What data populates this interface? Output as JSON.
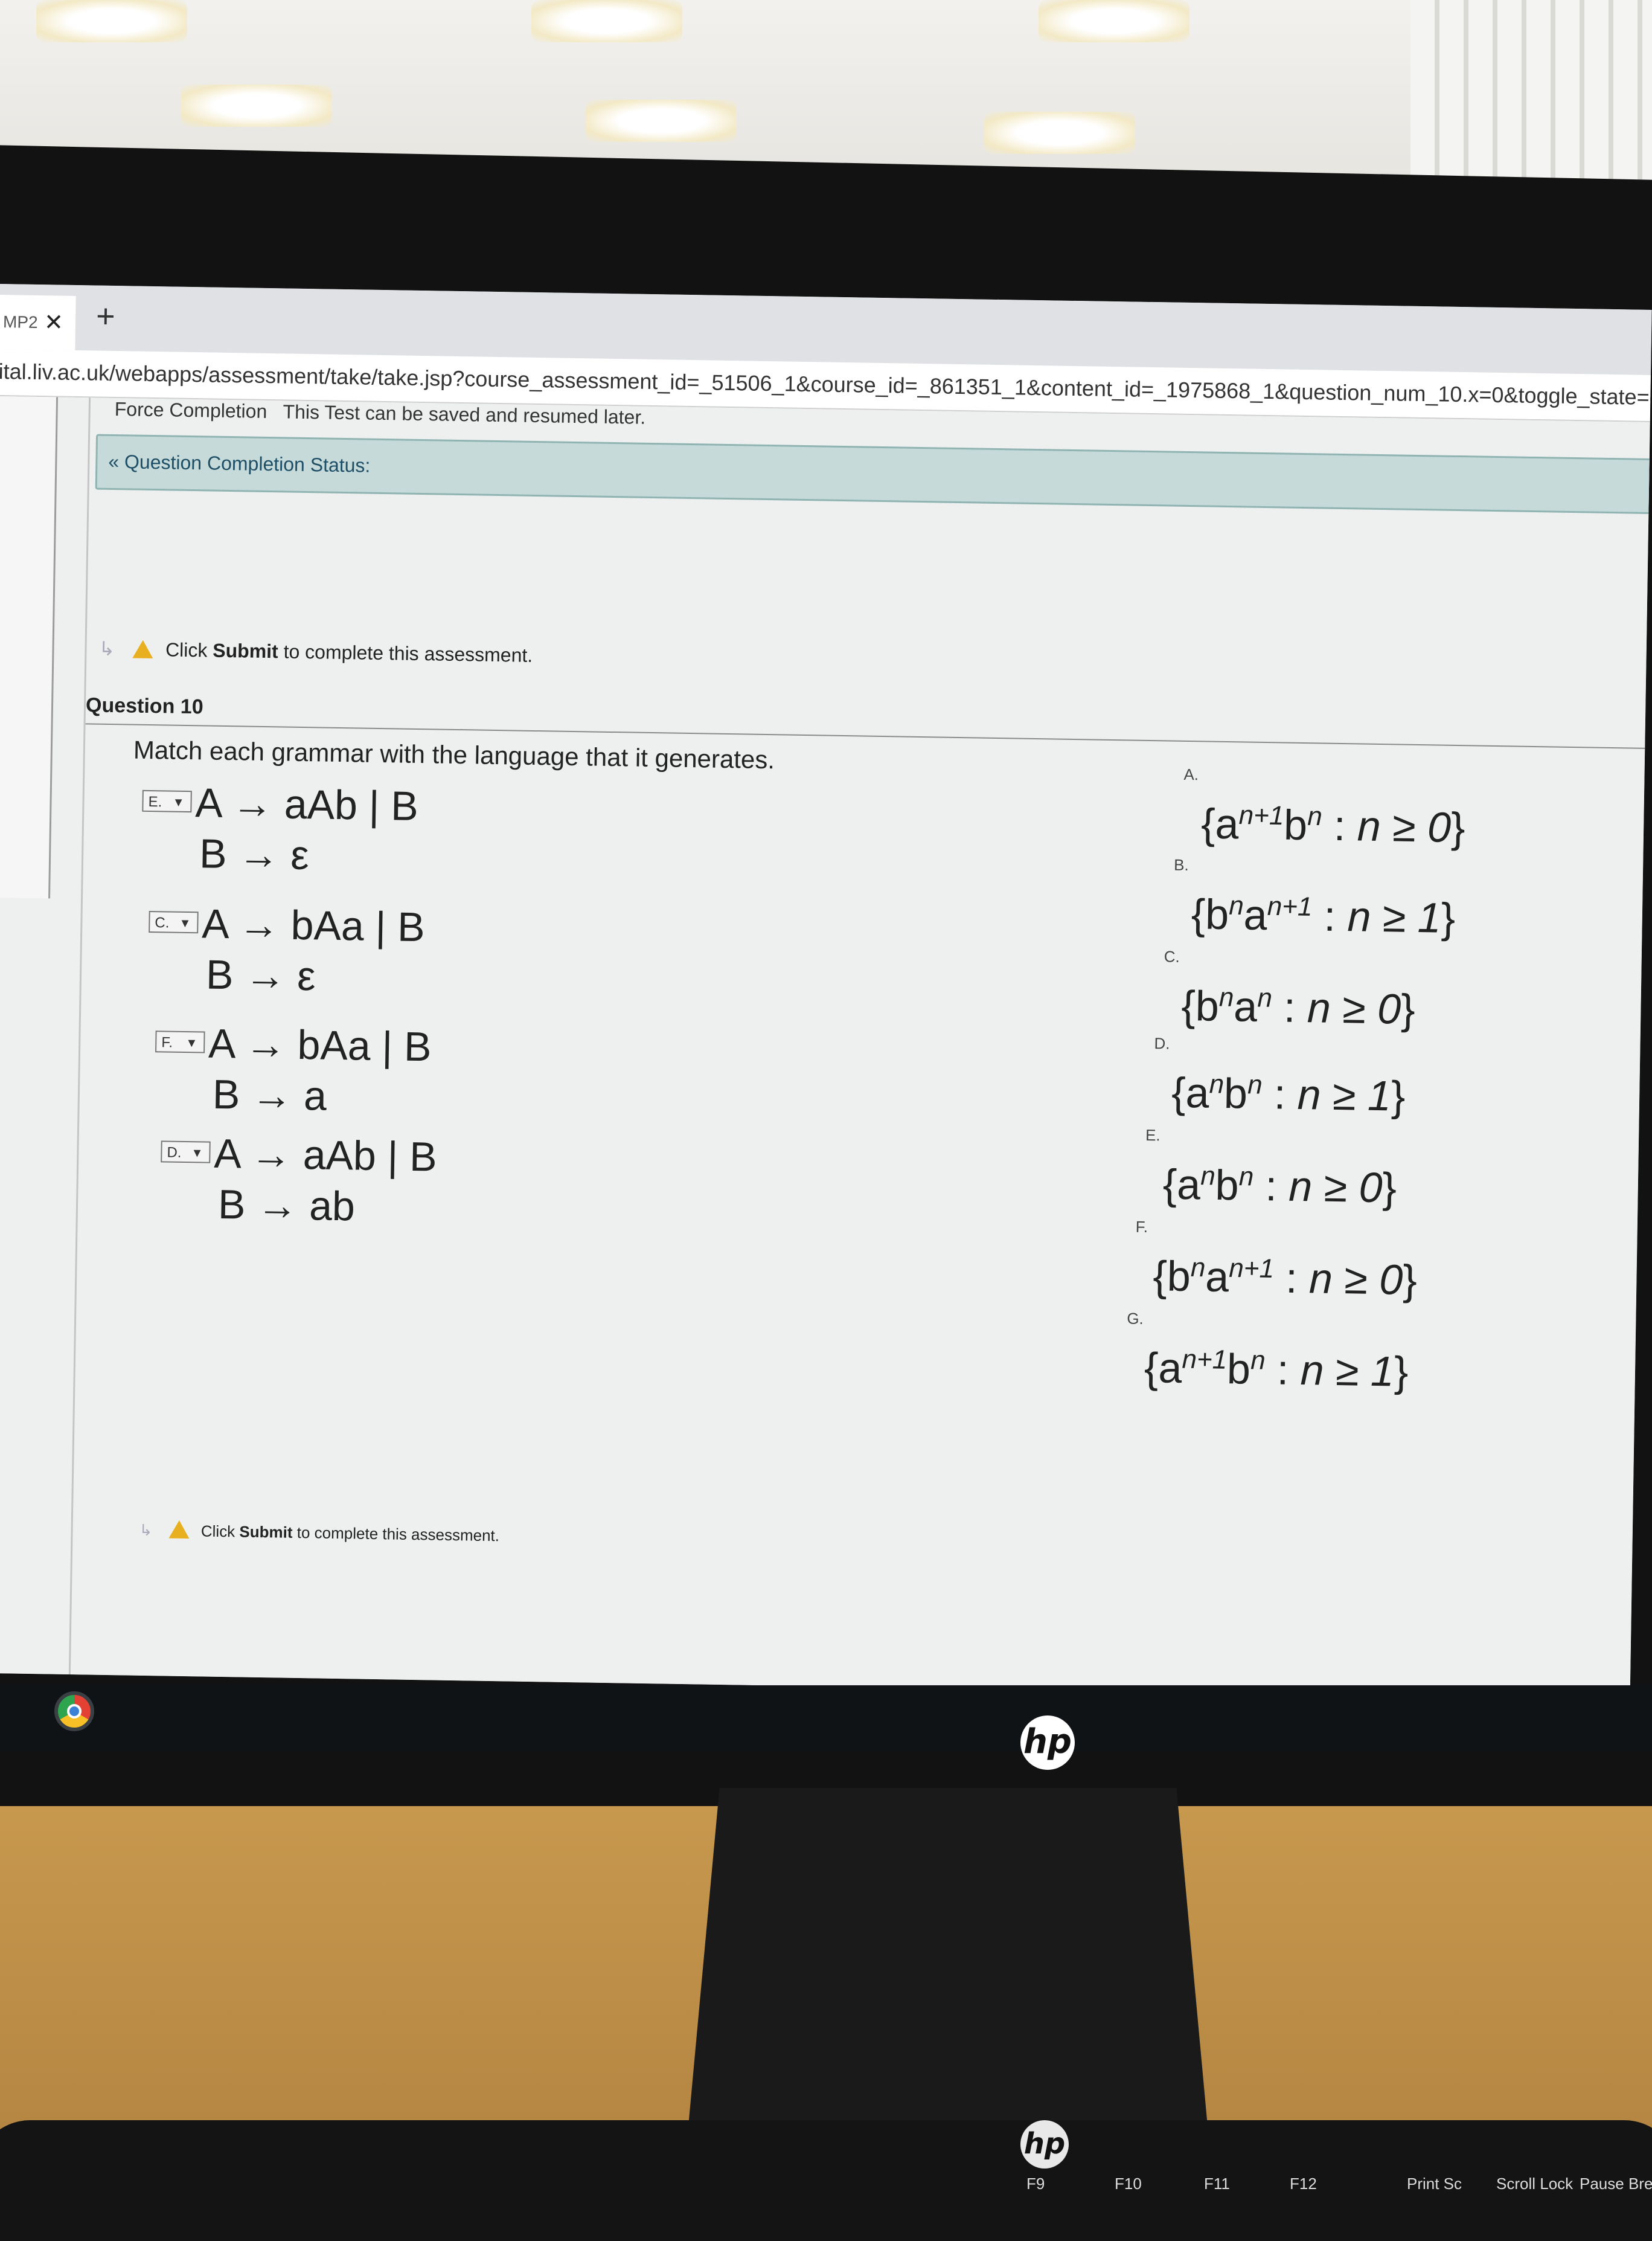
{
  "browser": {
    "tab_title": "MP2",
    "close_symbol": "✕",
    "new_tab_symbol": "+",
    "url": "ital.liv.ac.uk/webapps/assessment/take/take.jsp?course_assessment_id=_51506_1&course_id=_861351_1&content_id=_1975868_1&question_num_10.x=0&toggle_state=qShow&step=null"
  },
  "assessment": {
    "force_completion_label": "Force Completion",
    "force_completion_text": "This Test can be saved and resumed later.",
    "completion_status_label": "Question Completion Status:",
    "notice_prefix": "Click",
    "notice_submit": "Submit",
    "notice_suffix": "to complete this assessment."
  },
  "question": {
    "title": "Question 10",
    "prompt": "Match each grammar with the language that it generates.",
    "grammars": [
      {
        "answer": "E.",
        "line1": "A → aAb | B",
        "line2": "B → ε"
      },
      {
        "answer": "C.",
        "line1": "A → bAa | B",
        "line2": "B → ε"
      },
      {
        "answer": "F.",
        "line1": "A → bAa | B",
        "line2": "B → a"
      },
      {
        "answer": "D.",
        "line1": "A → aAb | B",
        "line2": "B → ab"
      }
    ],
    "languages": [
      {
        "letter": "A.",
        "a": "a",
        "sup1": "n+1",
        "b": "b",
        "sup2": "n",
        "cond": "n ≥ 0"
      },
      {
        "letter": "B.",
        "a": "b",
        "sup1": "n",
        "b": "a",
        "sup2": "n+1",
        "cond": "n ≥ 1"
      },
      {
        "letter": "C.",
        "a": "b",
        "sup1": "n",
        "b": "a",
        "sup2": "n",
        "cond": "n ≥ 0"
      },
      {
        "letter": "D.",
        "a": "a",
        "sup1": "n",
        "b": "b",
        "sup2": "n",
        "cond": "n ≥ 1"
      },
      {
        "letter": "E.",
        "a": "a",
        "sup1": "n",
        "b": "b",
        "sup2": "n",
        "cond": "n ≥ 0"
      },
      {
        "letter": "F.",
        "a": "b",
        "sup1": "n",
        "b": "a",
        "sup2": "n+1",
        "cond": "n ≥ 0"
      },
      {
        "letter": "G.",
        "a": "a",
        "sup1": "n+1",
        "b": "b",
        "sup2": "n",
        "cond": "n ≥ 1"
      }
    ]
  },
  "hardware": {
    "brand": "hp",
    "keys": [
      "F9",
      "F10",
      "F11",
      "F12",
      "Print Sc",
      "Scroll Lock",
      "Pause Break"
    ]
  },
  "colors": {
    "status_bar": "#c5dad9",
    "warning": "#e8b020"
  }
}
